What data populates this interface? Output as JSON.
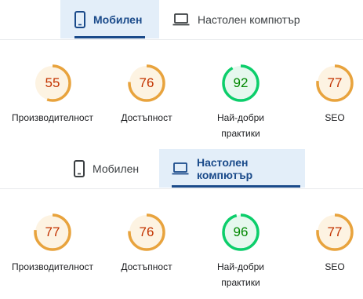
{
  "colors": {
    "orange": "#e8a33d",
    "orange_bg": "#fdf3e2",
    "orange_text": "#c33300",
    "green": "#0cce6b",
    "green_bg": "#e6f8ee",
    "green_text": "#008800",
    "accent": "#1a4a8a"
  },
  "top": {
    "tabs": [
      {
        "label": "Мобилен",
        "icon": "smartphone-icon",
        "active": true
      },
      {
        "label": "Настолен компютър",
        "icon": "laptop-icon",
        "active": false
      }
    ],
    "scores": [
      {
        "value": 55,
        "label": "Производителност",
        "status": "average"
      },
      {
        "value": 76,
        "label": "Достъпност",
        "status": "average"
      },
      {
        "value": 92,
        "label": "Най-добри практики",
        "status": "pass"
      },
      {
        "value": 77,
        "label": "SEO",
        "status": "average"
      }
    ]
  },
  "bottom": {
    "tabs": [
      {
        "label": "Мобилен",
        "icon": "smartphone-icon",
        "active": false
      },
      {
        "label": "Настолен компютър",
        "icon": "laptop-icon",
        "active": true
      }
    ],
    "scores": [
      {
        "value": 77,
        "label": "Производителност",
        "status": "average"
      },
      {
        "value": 76,
        "label": "Достъпност",
        "status": "average"
      },
      {
        "value": 96,
        "label": "Най-добри практики",
        "status": "pass"
      },
      {
        "value": 77,
        "label": "SEO",
        "status": "average"
      }
    ]
  }
}
